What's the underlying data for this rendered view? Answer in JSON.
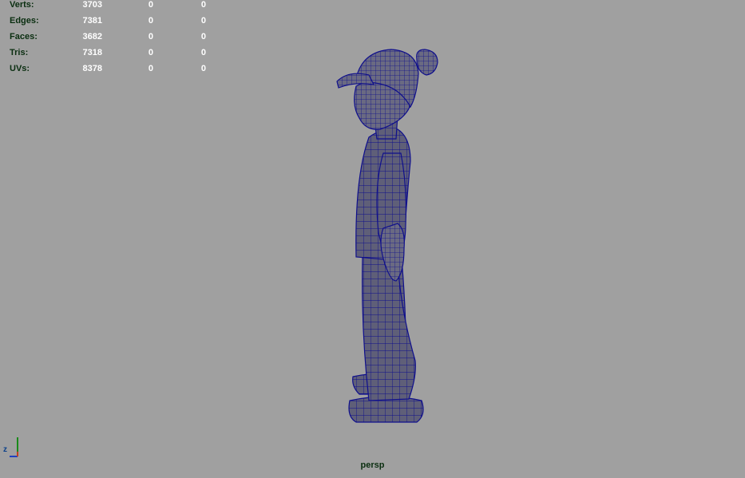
{
  "hud": {
    "rows": [
      {
        "label": "Verts:",
        "v1": "3703",
        "v2": "0",
        "v3": "0"
      },
      {
        "label": "Edges:",
        "v1": "7381",
        "v2": "0",
        "v3": "0"
      },
      {
        "label": "Faces:",
        "v1": "3682",
        "v2": "0",
        "v3": "0"
      },
      {
        "label": "Tris:",
        "v1": "7318",
        "v2": "0",
        "v3": "0"
      },
      {
        "label": "UVs:",
        "v1": "8378",
        "v2": "0",
        "v3": "0"
      }
    ]
  },
  "camera": {
    "name": "persp"
  },
  "axis": {
    "z_label": "z"
  },
  "colors": {
    "background": "#a0a0a0",
    "mesh_fill": "#5f5f78",
    "wire": "#0f0f8c",
    "hud_label": "#0a2e10"
  },
  "icons": {
    "axis_gizmo": "axis-gizmo-icon",
    "model": "character-wireframe"
  }
}
